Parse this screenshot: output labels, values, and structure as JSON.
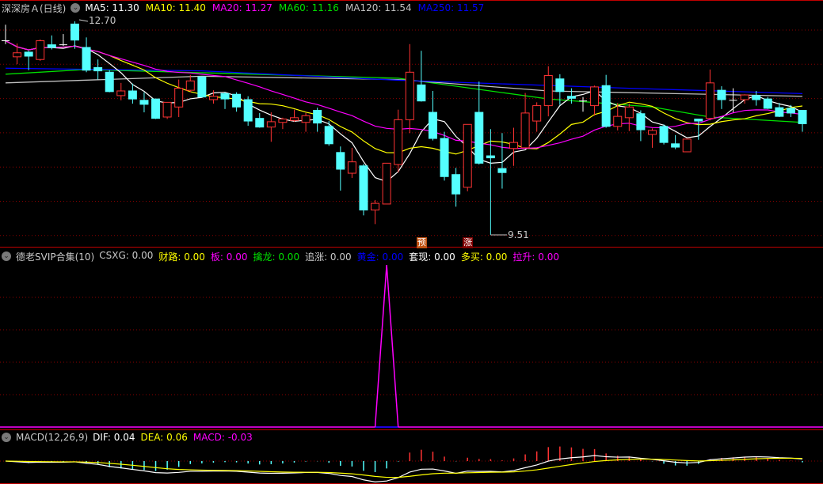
{
  "header": {
    "title": "深深房Ａ(日线)",
    "ma": [
      {
        "label": "MA5: 11.30",
        "color": "#ffffff"
      },
      {
        "label": "MA10: 11.40",
        "color": "#ffff00"
      },
      {
        "label": "MA20: 11.27",
        "color": "#ff00ff"
      },
      {
        "label": "MA60: 11.16",
        "color": "#00e000"
      },
      {
        "label": "MA120: 11.54",
        "color": "#c0c0c0"
      },
      {
        "label": "MA250: 11.57",
        "color": "#0000ff"
      }
    ]
  },
  "price_labels": {
    "high": "12.70",
    "low": "9.51"
  },
  "markers": [
    {
      "text": "预",
      "index": 36,
      "color": "#c05010"
    },
    {
      "text": "涨",
      "index": 40,
      "color": "#800000"
    }
  ],
  "indicator": {
    "title": "德老SVIP合集(10)",
    "items": [
      {
        "label": "CSXG: 0.00",
        "color": "#c8c8c8"
      },
      {
        "label": "财路: 0.00",
        "color": "#ffff00"
      },
      {
        "label": "板: 0.00",
        "color": "#ff00ff"
      },
      {
        "label": "擒龙: 0.00",
        "color": "#00e000"
      },
      {
        "label": "追涨: 0.00",
        "color": "#c8c8c8"
      },
      {
        "label": "黄金: 0.00",
        "color": "#0000ff"
      },
      {
        "label": "套现: 0.00",
        "color": "#ffffff"
      },
      {
        "label": "多买: 0.00",
        "color": "#ffff00"
      },
      {
        "label": "拉升: 0.00",
        "color": "#ff00ff"
      }
    ],
    "signal_index": 33
  },
  "macd": {
    "title": "MACD(12,26,9)",
    "items": [
      {
        "label": "DIF: 0.04",
        "color": "#ffffff"
      },
      {
        "label": "DEA: 0.06",
        "color": "#ffff00"
      },
      {
        "label": "MACD: -0.03",
        "color": "#ff00ff"
      }
    ]
  },
  "colors": {
    "up": "#ff3333",
    "down": "#54ffff",
    "grid": "#8b0000",
    "separator": "#c00000"
  },
  "chart_data": {
    "type": "candlestick",
    "ylim": [
      9.4,
      12.8
    ],
    "candles": [
      [
        12.41,
        12.41,
        12.65,
        12.36
      ],
      [
        12.17,
        12.23,
        12.37,
        12.06
      ],
      [
        12.24,
        12.18,
        12.26,
        11.97
      ],
      [
        12.13,
        12.41,
        12.43,
        12.11
      ],
      [
        12.35,
        12.31,
        12.49,
        12.28
      ],
      [
        12.35,
        12.35,
        12.51,
        12.33
      ],
      [
        12.66,
        12.42,
        12.7,
        12.29
      ],
      [
        12.31,
        11.97,
        12.46,
        11.94
      ],
      [
        12.01,
        11.96,
        12.13,
        11.83
      ],
      [
        11.94,
        11.65,
        11.97,
        11.64
      ],
      [
        11.59,
        11.66,
        11.78,
        11.52
      ],
      [
        11.66,
        11.54,
        11.77,
        11.47
      ],
      [
        11.52,
        11.46,
        11.64,
        11.34
      ],
      [
        11.54,
        11.25,
        11.54,
        11.24
      ],
      [
        11.27,
        11.49,
        11.49,
        11.24
      ],
      [
        11.42,
        11.7,
        11.83,
        11.27
      ],
      [
        11.67,
        11.81,
        11.9,
        11.64
      ],
      [
        11.87,
        11.57,
        11.87,
        11.57
      ],
      [
        11.53,
        11.58,
        11.67,
        11.47
      ],
      [
        11.62,
        11.54,
        11.64,
        11.39
      ],
      [
        11.61,
        11.42,
        11.64,
        11.35
      ],
      [
        11.53,
        11.21,
        11.58,
        11.14
      ],
      [
        11.25,
        11.12,
        11.33,
        11.11
      ],
      [
        11.12,
        11.2,
        11.34,
        10.9
      ],
      [
        11.19,
        11.24,
        11.26,
        11.09
      ],
      [
        11.22,
        11.26,
        11.38,
        11.2
      ],
      [
        11.19,
        11.29,
        11.33,
        11.05
      ],
      [
        11.37,
        11.18,
        11.41,
        11.05
      ],
      [
        11.13,
        10.87,
        11.21,
        10.84
      ],
      [
        10.74,
        10.49,
        10.83,
        10.17
      ],
      [
        10.43,
        10.6,
        10.81,
        10.36
      ],
      [
        10.54,
        9.88,
        10.57,
        9.8
      ],
      [
        9.88,
        9.98,
        10.03,
        9.67
      ],
      [
        9.97,
        10.58,
        10.58,
        9.97
      ],
      [
        10.56,
        11.23,
        11.38,
        10.44
      ],
      [
        11.23,
        11.94,
        12.36,
        11.03
      ],
      [
        11.75,
        11.51,
        12.26,
        11.5
      ],
      [
        11.34,
        10.95,
        11.66,
        10.92
      ],
      [
        10.95,
        10.38,
        11.05,
        10.32
      ],
      [
        10.41,
        10.12,
        10.51,
        9.93
      ],
      [
        10.22,
        11.16,
        11.16,
        10.16
      ],
      [
        11.34,
        10.58,
        11.8,
        10.56
      ],
      [
        10.69,
        10.66,
        11.09,
        9.51
      ],
      [
        10.5,
        10.44,
        11.03,
        10.2
      ],
      [
        10.8,
        10.89,
        11.11,
        10.54
      ],
      [
        10.81,
        11.33,
        11.63,
        10.81
      ],
      [
        11.21,
        11.44,
        11.49,
        11.05
      ],
      [
        11.44,
        11.89,
        12.03,
        11.28
      ],
      [
        11.84,
        11.65,
        11.91,
        11.45
      ],
      [
        11.58,
        11.55,
        11.7,
        11.47
      ],
      [
        11.51,
        11.51,
        11.57,
        11.35
      ],
      [
        11.44,
        11.72,
        11.74,
        11.29
      ],
      [
        11.74,
        11.13,
        11.9,
        11.11
      ],
      [
        11.13,
        11.28,
        11.48,
        11.07
      ],
      [
        11.26,
        11.42,
        11.47,
        11.06
      ],
      [
        11.32,
        11.08,
        11.37,
        10.91
      ],
      [
        11.01,
        11.07,
        11.1,
        10.81
      ],
      [
        11.13,
        10.89,
        11.16,
        10.86
      ],
      [
        10.87,
        10.82,
        11.0,
        10.79
      ],
      [
        10.75,
        10.94,
        10.94,
        10.75
      ],
      [
        11.24,
        11.21,
        11.24,
        10.93
      ],
      [
        11.25,
        11.78,
        11.98,
        11.22
      ],
      [
        11.67,
        11.53,
        11.73,
        11.39
      ],
      [
        11.52,
        11.52,
        11.7,
        11.34
      ],
      [
        11.53,
        11.6,
        11.61,
        11.47
      ],
      [
        11.59,
        11.53,
        11.66,
        11.44
      ],
      [
        11.54,
        11.4,
        11.57,
        11.39
      ],
      [
        11.41,
        11.28,
        11.48,
        11.27
      ],
      [
        11.4,
        11.33,
        11.45,
        11.27
      ],
      [
        11.37,
        11.17,
        11.37,
        11.05
      ]
    ],
    "long_ma": {
      "MA60": [
        [
          0,
          11.91
        ],
        [
          7,
          11.98
        ],
        [
          34,
          11.85
        ],
        [
          47,
          11.54
        ],
        [
          56,
          11.42
        ],
        [
          61,
          11.27
        ],
        [
          69,
          11.19
        ]
      ],
      "MA120": [
        [
          0,
          11.78
        ],
        [
          17,
          11.88
        ],
        [
          34,
          11.83
        ],
        [
          47,
          11.66
        ],
        [
          58,
          11.62
        ],
        [
          69,
          11.58
        ]
      ],
      "MA250": [
        [
          0,
          12.0
        ],
        [
          17,
          11.96
        ],
        [
          34,
          11.82
        ],
        [
          54,
          11.7
        ],
        [
          69,
          11.62
        ]
      ]
    }
  }
}
